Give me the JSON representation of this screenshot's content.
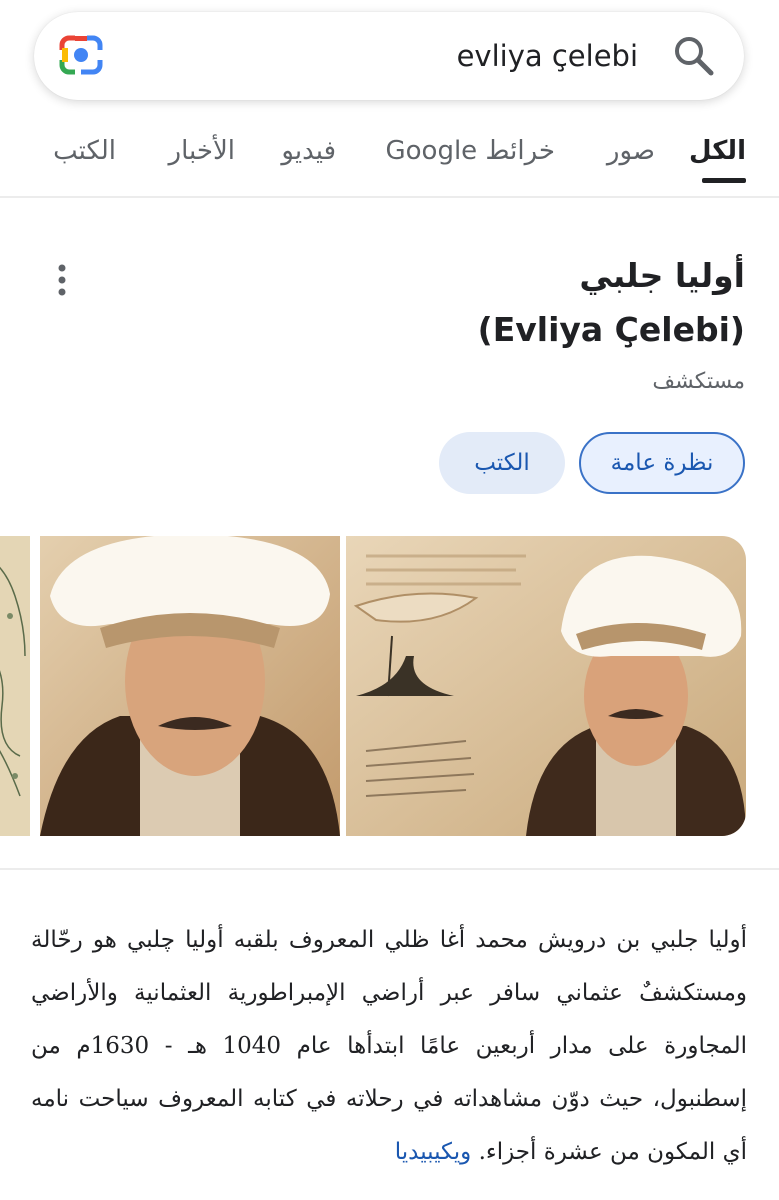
{
  "search": {
    "query": "evliya çelebi"
  },
  "tabs": [
    {
      "label": "الكل"
    },
    {
      "label": "صور"
    },
    {
      "label": "خرائط Google"
    },
    {
      "label": "فيديو"
    },
    {
      "label": "الأخبار"
    },
    {
      "label": "الكتب"
    }
  ],
  "knowledge_panel": {
    "title": "أوليا جلبي",
    "title_latin": "(Evliya Çelebi)",
    "subtitle": "مستكشف",
    "chips": [
      {
        "label": "نظرة عامة"
      },
      {
        "label": "الكتب"
      }
    ],
    "description": "أوليا جلبي بن درويش محمد أغا ظلي المعروف بلقبه أوليا چلبي هو رحّالة ومستكشفٌ عثماني سافر عبر أراضي الإمبراطورية العثمانية والأراضي المجاورة على مدار أربعين عامًا ابتدأها عام 1040 هـ - 1630م من إسطنبول، حيث دوّن مشاهداته في رحلاته في كتابه المعروف سياحت نامه أي المكون من عشرة أجزاء.",
    "source_link": "ويكيبيديا"
  },
  "colors": {
    "accent": "#1a57b0",
    "chip_bg": "#e8f0fe",
    "text": "#202124",
    "muted": "#5f6368"
  },
  "icons": [
    "google-lens-icon",
    "search-icon",
    "more-vert-icon"
  ]
}
